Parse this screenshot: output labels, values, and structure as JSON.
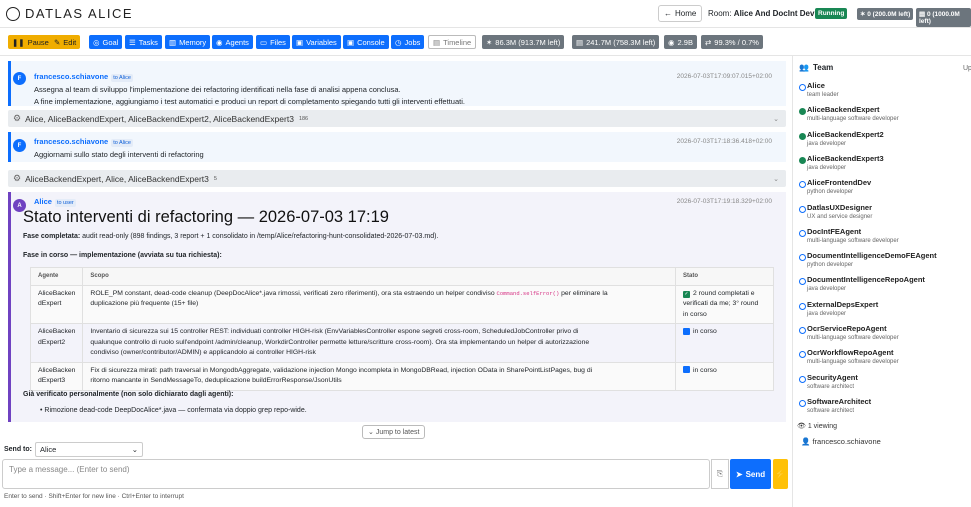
{
  "app": {
    "logo": "DATLAS ALICE"
  },
  "header": {
    "home_label": "Home",
    "room_label": "Room:",
    "room_name": "Alice And DocInt Dev",
    "status": "Running",
    "quotas": [
      "0 (200.0M left)",
      "0 (1000.0M left)"
    ]
  },
  "toolbar": {
    "buttons": [
      "Pause",
      "Edit",
      "Goal",
      "Tasks",
      "Memory",
      "Agents",
      "Files",
      "Variables",
      "Console",
      "Jobs",
      "Timeline"
    ],
    "stats": [
      "86.3M (913.7M left)",
      "241.7M (758.3M left)",
      "2.9B",
      "99.3% / 0.7%"
    ]
  },
  "messages": [
    {
      "avatar": "F",
      "author": "francesco.schiavone",
      "to": "to Alice",
      "timestamp": "2026-07-03T17:09:07.015+02:00",
      "lines": [
        "Assegna al team di sviluppo l'implementazione dei refactoring identificati nella fase di analisi appena conclusa.",
        "A fine implementazione, aggiungiamo i test automatici e produci un report di completamento spiegando tutti gli interventi effettuati."
      ]
    },
    {
      "avatar": "F",
      "author": "francesco.schiavone",
      "to": "to Alice",
      "timestamp": "2026-07-03T17:18:36.418+02:00",
      "lines": [
        "Aggiornami sullo stato degli interventi di refactoring"
      ]
    }
  ],
  "folds": [
    {
      "label": "Alice, AliceBackendExpert, AliceBackendExpert2, AliceBackendExpert3",
      "count": "186"
    },
    {
      "label": "AliceBackendExpert, Alice, AliceBackendExpert3",
      "count": "5"
    }
  ],
  "report": {
    "avatar": "A",
    "author": "Alice",
    "to": "to user",
    "timestamp": "2026-07-03T17:19:18.329+02:00",
    "title": "Stato interventi di refactoring — 2026-07-03 17:19",
    "phase_done_label": "Fase completata:",
    "phase_done_text": " audit read-only (898 findings, 3 report + 1 consolidato in /temp/Alice/refactoring-hunt-consolidated-2026-07-03.md).",
    "phase_running": "Fase in corso — implementazione (avviata su tua richiesta):",
    "table": {
      "headers": [
        "Agente",
        "Scopo",
        "Stato"
      ],
      "rows": [
        {
          "agent_a": "AliceBacken",
          "agent_b": "dExpert",
          "scope_1": "ROLE_PM constant, dead-code cleanup (DeepDocAlice*.java rimossi, verificati zero riferimenti), ora sta estraendo un helper condiviso ",
          "scope_code": "Command.selfError()",
          "scope_2": " per eliminare la",
          "scope_3": "duplicazione più frequente (15+ file)",
          "state_1": "2 round completati e",
          "state_2": "verificati da me; 3° round",
          "state_3": "in corso"
        },
        {
          "agent_a": "AliceBacken",
          "agent_b": "dExpert2",
          "scope_1": "Inventario di sicurezza sui 15 controller REST: individuati controller HIGH-risk (EnvVariablesController espone segreti cross-room, ScheduledJobController privo di",
          "scope_2": "qualunque controllo di ruolo sull'endpoint /admin/cleanup, WorkdirController permette letture/scritture cross-room). Ora sta implementando un helper di autorizzazione",
          "scope_3": "condiviso (owner/contributor/ADMIN) e applicandolo ai controller HIGH-risk",
          "state_1": "in corso"
        },
        {
          "agent_a": "AliceBacken",
          "agent_b": "dExpert3",
          "scope_1": "Fix di sicurezza mirati: path traversal in MongodbAggregate, validazione injection Mongo incompleta in MongoDBRead, injection OData in SharePointListPages, bug di",
          "scope_2": "ritorno mancante in SendMessageTo, deduplicazione buildErrorResponse/JsonUtils",
          "state_1": "in corso"
        }
      ]
    },
    "verified_label": "Già verificato personalmente (non solo dichiarato dagli agenti):",
    "bullet": "Rimozione dead-code DeepDocAlice*.java — confermata via doppio grep repo-wide."
  },
  "jump_label": "Jump to latest",
  "composer": {
    "send_to_label": "Send to:",
    "send_to_value": "Alice",
    "placeholder": "Type a message... (Enter to send)",
    "send_label": "Send",
    "hint": "Enter to send · Shift+Enter for new line · Ctrl+Enter to interrupt"
  },
  "sidebar": {
    "title": "Team",
    "up_label": "Up",
    "members": [
      {
        "name": "Alice",
        "role": "team leader",
        "online": false
      },
      {
        "name": "AliceBackendExpert",
        "role": "multi-language software developer",
        "online": true
      },
      {
        "name": "AliceBackendExpert2",
        "role": "java developer",
        "online": true
      },
      {
        "name": "AliceBackendExpert3",
        "role": "java developer",
        "online": true
      },
      {
        "name": "AliceFrontendDev",
        "role": "python developer",
        "online": false
      },
      {
        "name": "DatlasUXDesigner",
        "role": "UX and service designer",
        "online": false
      },
      {
        "name": "DocIntFEAgent",
        "role": "multi-language software developer",
        "online": false
      },
      {
        "name": "DocumentIntelligenceDemoFEAgent",
        "role": "python developer",
        "online": false
      },
      {
        "name": "DocumentIntelligenceRepoAgent",
        "role": "java developer",
        "online": false
      },
      {
        "name": "ExternalDepsExpert",
        "role": "java developer",
        "online": false
      },
      {
        "name": "OcrServiceRepoAgent",
        "role": "multi-language software developer",
        "online": false
      },
      {
        "name": "OcrWorkflowRepoAgent",
        "role": "multi-language software developer",
        "online": false
      },
      {
        "name": "SecurityAgent",
        "role": "software architect",
        "online": false
      },
      {
        "name": "SoftwareArchitect",
        "role": "software architect",
        "online": false
      }
    ],
    "viewing": "1 viewing",
    "viewer": "francesco.schiavone"
  }
}
